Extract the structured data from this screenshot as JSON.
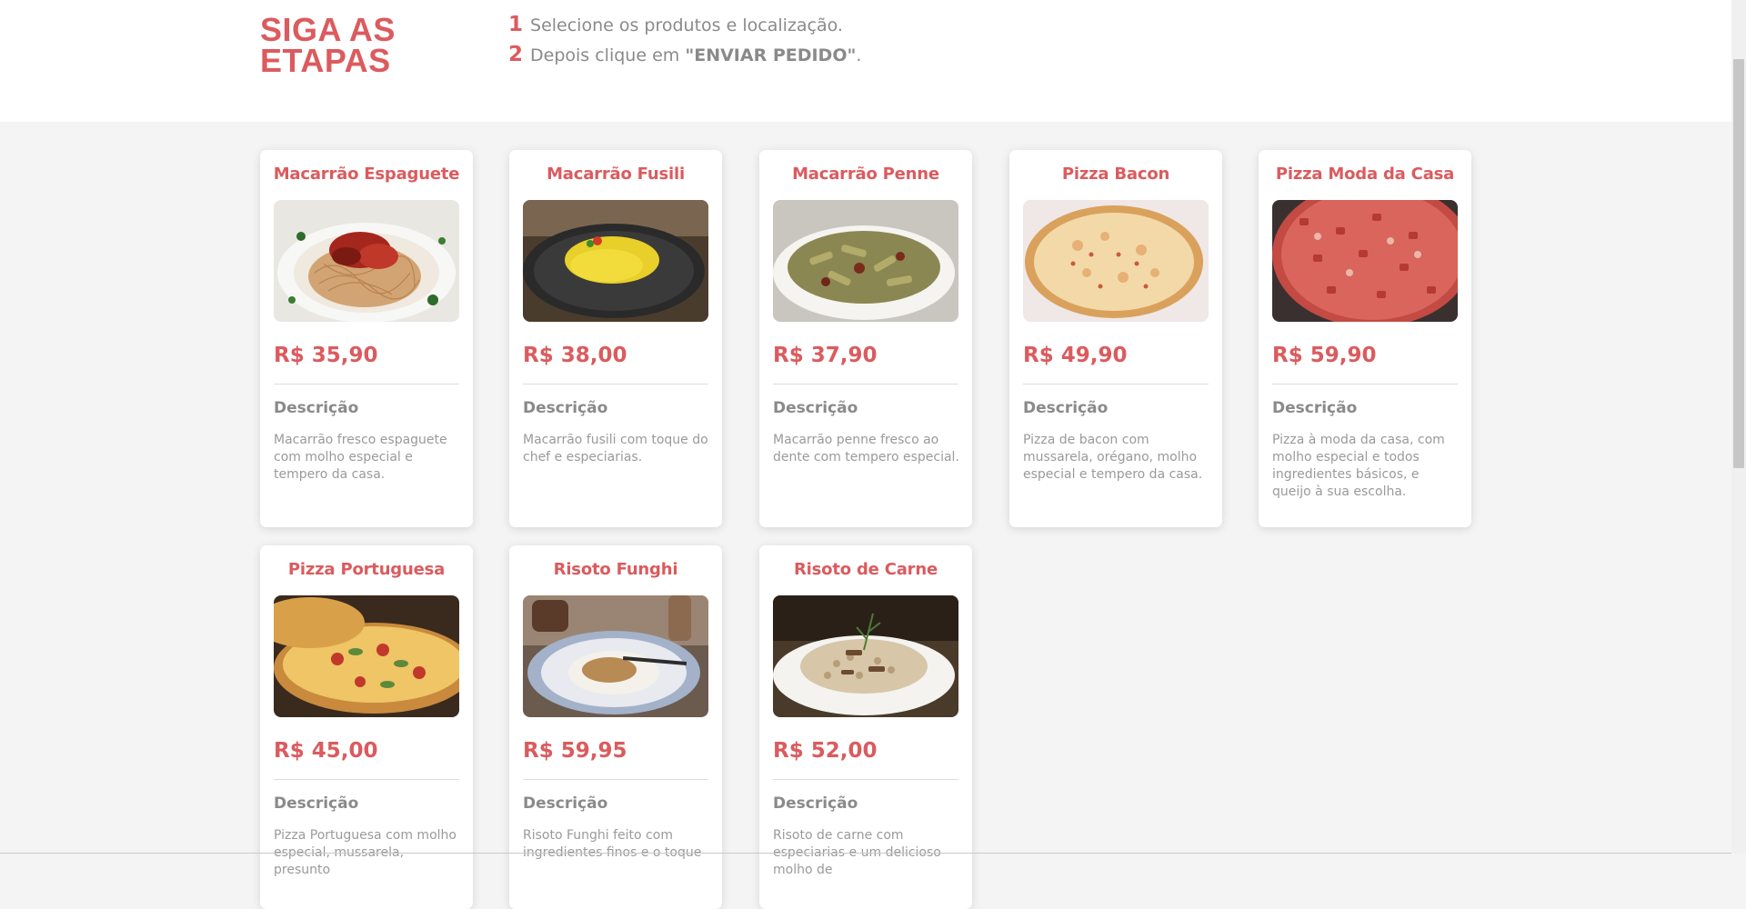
{
  "steps": {
    "title_line1": "SIGA AS",
    "title_line2": "ETAPAS",
    "items": [
      {
        "number": "1",
        "text": "Selecione os produtos e localização."
      },
      {
        "number": "2",
        "text_before": "Depois clique em ",
        "emphasis": "\"ENVIAR PEDIDO\"",
        "text_after": "."
      }
    ]
  },
  "products": [
    {
      "name": "Macarrão Espaguete",
      "price": "R$ 35,90",
      "desc_label": "Descrição",
      "description": "Macarrão fresco espaguete com molho especial e tempero da casa.",
      "image": "spaghetti-photo"
    },
    {
      "name": "Macarrão Fusili",
      "price": "R$ 38,00",
      "desc_label": "Descrição",
      "description": "Macarrão fusili com toque do chef e especiarias.",
      "image": "fusilli-photo"
    },
    {
      "name": "Macarrão Penne",
      "price": "R$ 37,90",
      "desc_label": "Descrição",
      "description": "Macarrão penne fresco ao dente com tempero especial.",
      "image": "penne-photo"
    },
    {
      "name": "Pizza Bacon",
      "price": "R$ 49,90",
      "desc_label": "Descrição",
      "description": "Pizza de bacon com mussarela, orégano, molho especial e tempero da casa.",
      "image": "bacon-pizza-photo"
    },
    {
      "name": "Pizza Moda da Casa",
      "price": "R$ 59,90",
      "desc_label": "Descrição",
      "description": "Pizza à moda da casa, com molho especial e todos ingredientes básicos, e queijo à sua escolha.",
      "image": "house-pizza-photo"
    },
    {
      "name": "Pizza Portuguesa",
      "price": "R$ 45,00",
      "desc_label": "Descrição",
      "description": "Pizza Portuguesa com molho especial, mussarela, presunto",
      "image": "portuguese-pizza-photo"
    },
    {
      "name": "Risoto Funghi",
      "price": "R$ 59,95",
      "desc_label": "Descrição",
      "description": "Risoto Funghi feito com ingredientes finos e o toque",
      "image": "funghi-risotto-photo"
    },
    {
      "name": "Risoto de Carne",
      "price": "R$ 52,00",
      "desc_label": "Descrição",
      "description": "Risoto de carne com especiarias e um delicioso molho de",
      "image": "meat-risotto-photo"
    }
  ],
  "colors": {
    "accent": "#db5b5e",
    "muted_text": "#8a8a8a",
    "background": "#f4f4f4"
  }
}
